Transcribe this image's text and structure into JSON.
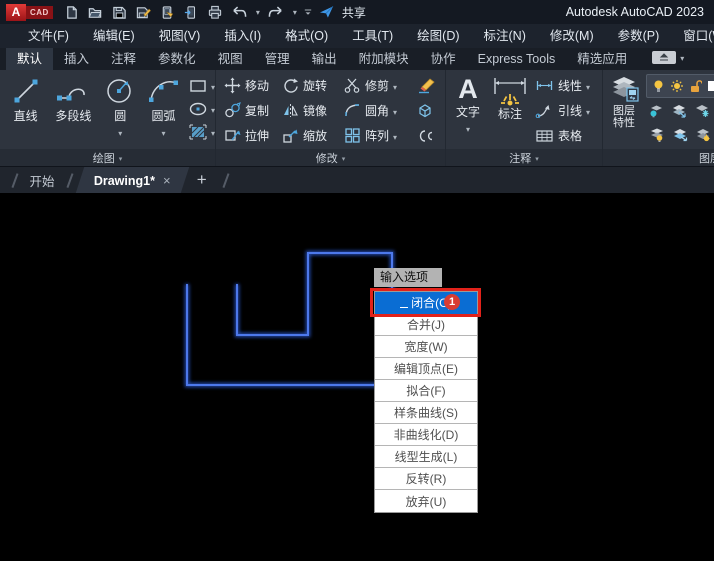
{
  "app": {
    "logo_a": "A",
    "logo_cad": "CAD",
    "share_label": "共享",
    "title": "Autodesk AutoCAD 2023"
  },
  "menu_bar": {
    "items": [
      "文件(F)",
      "编辑(E)",
      "视图(V)",
      "插入(I)",
      "格式(O)",
      "工具(T)",
      "绘图(D)",
      "标注(N)",
      "修改(M)",
      "参数(P)",
      "窗口(W)"
    ]
  },
  "ribbon_tabs": {
    "items": [
      "默认",
      "插入",
      "注释",
      "参数化",
      "视图",
      "管理",
      "输出",
      "附加模块",
      "协作",
      "Express Tools",
      "精选应用"
    ],
    "active": "默认"
  },
  "ribbon": {
    "draw": {
      "label": "绘图",
      "tools": {
        "line": "直线",
        "polyline": "多段线",
        "circle": "圆",
        "arc": "圆弧"
      }
    },
    "modify": {
      "label": "修改",
      "tools": {
        "move": "移动",
        "rotate": "旋转",
        "trim": "修剪",
        "copy": "复制",
        "mirror": "镜像",
        "fillet": "圆角",
        "stretch": "拉伸",
        "scale": "缩放",
        "array": "阵列"
      }
    },
    "annotate": {
      "label": "注释",
      "tools": {
        "text": "文字",
        "dimension": "标注",
        "linear": "线性",
        "leader": "引线",
        "table": "表格"
      }
    },
    "layers": {
      "label": "图层",
      "properties_tool": "图层特性"
    }
  },
  "file_tabs": {
    "start": "开始",
    "active": "Drawing1*",
    "close": "×",
    "new": "+"
  },
  "context_menu": {
    "header": "输入选项",
    "items": [
      {
        "label": "闭合(C)",
        "highlighted": true,
        "badge": "1"
      },
      {
        "label": "合并(J)"
      },
      {
        "label": "宽度(W)"
      },
      {
        "label": "编辑顶点(E)"
      },
      {
        "label": "拟合(F)"
      },
      {
        "label": "样条曲线(S)"
      },
      {
        "label": "非曲线化(D)"
      },
      {
        "label": "线型生成(L)"
      },
      {
        "label": "反转(R)"
      },
      {
        "label": "放弃(U)"
      }
    ]
  },
  "colors": {
    "highlight_blue": "#0a6dd3",
    "annotation_red": "#e2221a",
    "polyline_blue": "#3f6fe8",
    "accent_yellow": "#f5c542",
    "icon_blue": "#8fd0f0"
  }
}
